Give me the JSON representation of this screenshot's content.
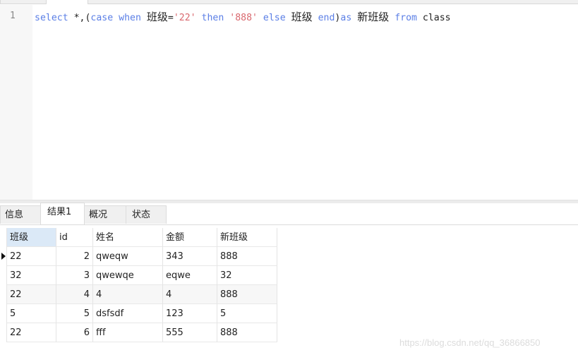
{
  "editor": {
    "line_number": "1",
    "sql": {
      "t1": "select",
      "t2": " *,(",
      "t3": "case",
      "t4": " ",
      "t5": "when",
      "t6": " ",
      "t7": "班级",
      "t8": "=",
      "t9": "'22'",
      "t10": " ",
      "t11": "then",
      "t12": " ",
      "t13": "'888'",
      "t14": " ",
      "t15": "else",
      "t16": " ",
      "t17": "班级",
      "t18": " ",
      "t19": "end",
      "t20": ")",
      "t21": "as",
      "t22": " ",
      "t23": "新班级",
      "t24": " ",
      "t25": "from",
      "t26": " ",
      "t27": "class"
    }
  },
  "result_tabs": [
    {
      "label": "信息"
    },
    {
      "label": "结果1"
    },
    {
      "label": "概况"
    },
    {
      "label": "状态"
    }
  ],
  "active_tab": "结果1",
  "table": {
    "columns": [
      "班级",
      "id",
      "姓名",
      "金额",
      "新班级"
    ],
    "rows": [
      [
        "22",
        "2",
        "qweqw",
        "343",
        "888"
      ],
      [
        "32",
        "3",
        "qwewqe",
        "eqwe",
        "32"
      ],
      [
        "22",
        "4",
        "4",
        "4",
        "888"
      ],
      [
        "5",
        "5",
        "dsfsdf",
        "123",
        "5"
      ],
      [
        "22",
        "6",
        "fff",
        "555",
        "888"
      ]
    ]
  },
  "watermark": "https://blog.csdn.net/qq_36866850"
}
